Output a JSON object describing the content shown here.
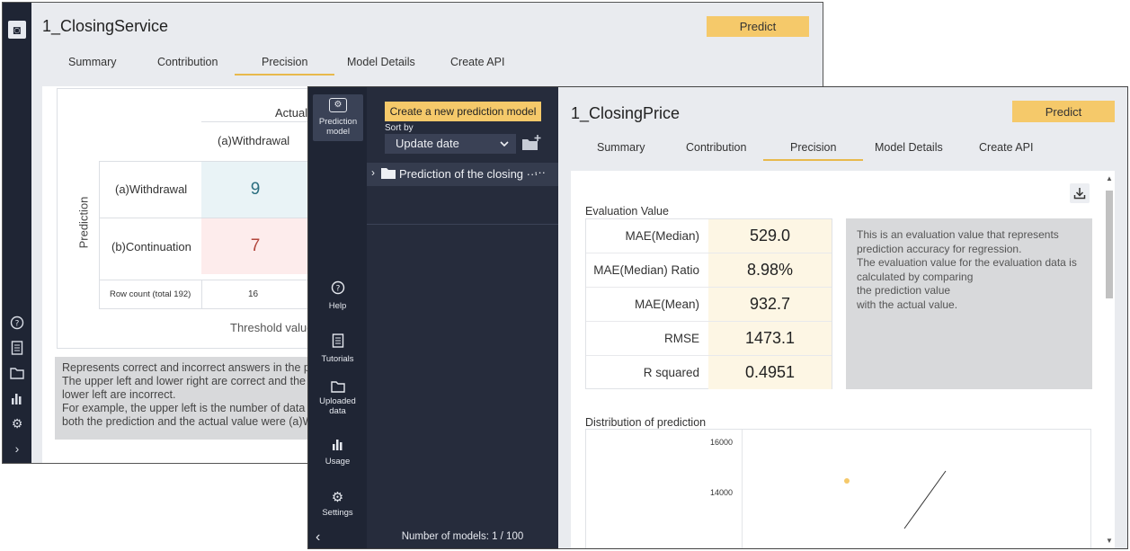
{
  "back_window": {
    "title": "1_ClosingService",
    "predict_label": "Predict",
    "tabs": [
      "Summary",
      "Contribution",
      "Precision",
      "Model Details",
      "Create API"
    ],
    "active_tab": "Precision",
    "matrix": {
      "actual_header": "Actual v",
      "column_header": "(a)Withdrawal",
      "row_axis_label": "Prediction",
      "rows": [
        {
          "label": "(a)Withdrawal",
          "value": "9"
        },
        {
          "label": "(b)Continuation",
          "value": "7"
        }
      ],
      "row_count_label": "Row count (total 192)",
      "row_count_value": "16",
      "threshold_label": "Threshold value"
    },
    "description_lines": [
      "Represents correct and incorrect answers in the pr",
      " The upper left and lower right are correct and the",
      "lower left are incorrect.",
      " For example, the upper left is the number of data",
      "both the prediction and the actual value were (a)W"
    ],
    "rail_icons": [
      "help-icon",
      "document-icon",
      "folder-icon",
      "usage-icon",
      "settings-icon",
      "chevron-right-icon"
    ]
  },
  "front_window": {
    "rail": {
      "items": [
        {
          "label": "Prediction model",
          "icon": "prediction-model-icon"
        },
        {
          "label": "Help",
          "icon": "help-icon"
        },
        {
          "label": "Tutorials",
          "icon": "tutorials-icon"
        },
        {
          "label": "Uploaded data",
          "icon": "folder-icon"
        },
        {
          "label": "Usage",
          "icon": "usage-icon"
        },
        {
          "label": "Settings",
          "icon": "settings-icon"
        }
      ],
      "collapse_glyph": "‹"
    },
    "model_panel": {
      "new_model_label": "Create a new prediction model",
      "sort_label": "Sort by",
      "sort_value": "Update date",
      "tree_item": "Prediction of the closing ···",
      "more_glyph": "···",
      "models_count": "Number of models: 1 / 100"
    },
    "title": "1_ClosingPrice",
    "predict_label": "Predict",
    "tabs": [
      "Summary",
      "Contribution",
      "Precision",
      "Model Details",
      "Create API"
    ],
    "active_tab": "Precision",
    "evaluation": {
      "title": "Evaluation Value",
      "rows": [
        {
          "label": "MAE(Median)",
          "value": "529.0"
        },
        {
          "label": "MAE(Median) Ratio",
          "value": "8.98%"
        },
        {
          "label": "MAE(Mean)",
          "value": "932.7"
        },
        {
          "label": "RMSE",
          "value": "1473.1"
        },
        {
          "label": "R squared",
          "value": "0.4951"
        }
      ],
      "description": "This is an evaluation value that represents prediction accuracy for regression.\n The evaluation value for the evaluation data is calculated by comparing\n the prediction value\n with the actual value."
    },
    "distribution": {
      "title": "Distribution of prediction",
      "y_ticks": [
        "16000",
        "14000"
      ]
    }
  },
  "colors": {
    "rail": "#1f2534",
    "panel": "#262c3c",
    "accent": "#f5c96a",
    "correct_cell": "#e9f3f6",
    "incorrect_cell": "#fdecec",
    "eval_value_bg": "#fdf6e4",
    "point": "#f5c96a"
  },
  "chart_data": {
    "type": "scatter",
    "title": "Distribution of prediction",
    "y_ticks": [
      16000,
      14000
    ],
    "points": [
      {
        "y": 14500
      }
    ]
  }
}
